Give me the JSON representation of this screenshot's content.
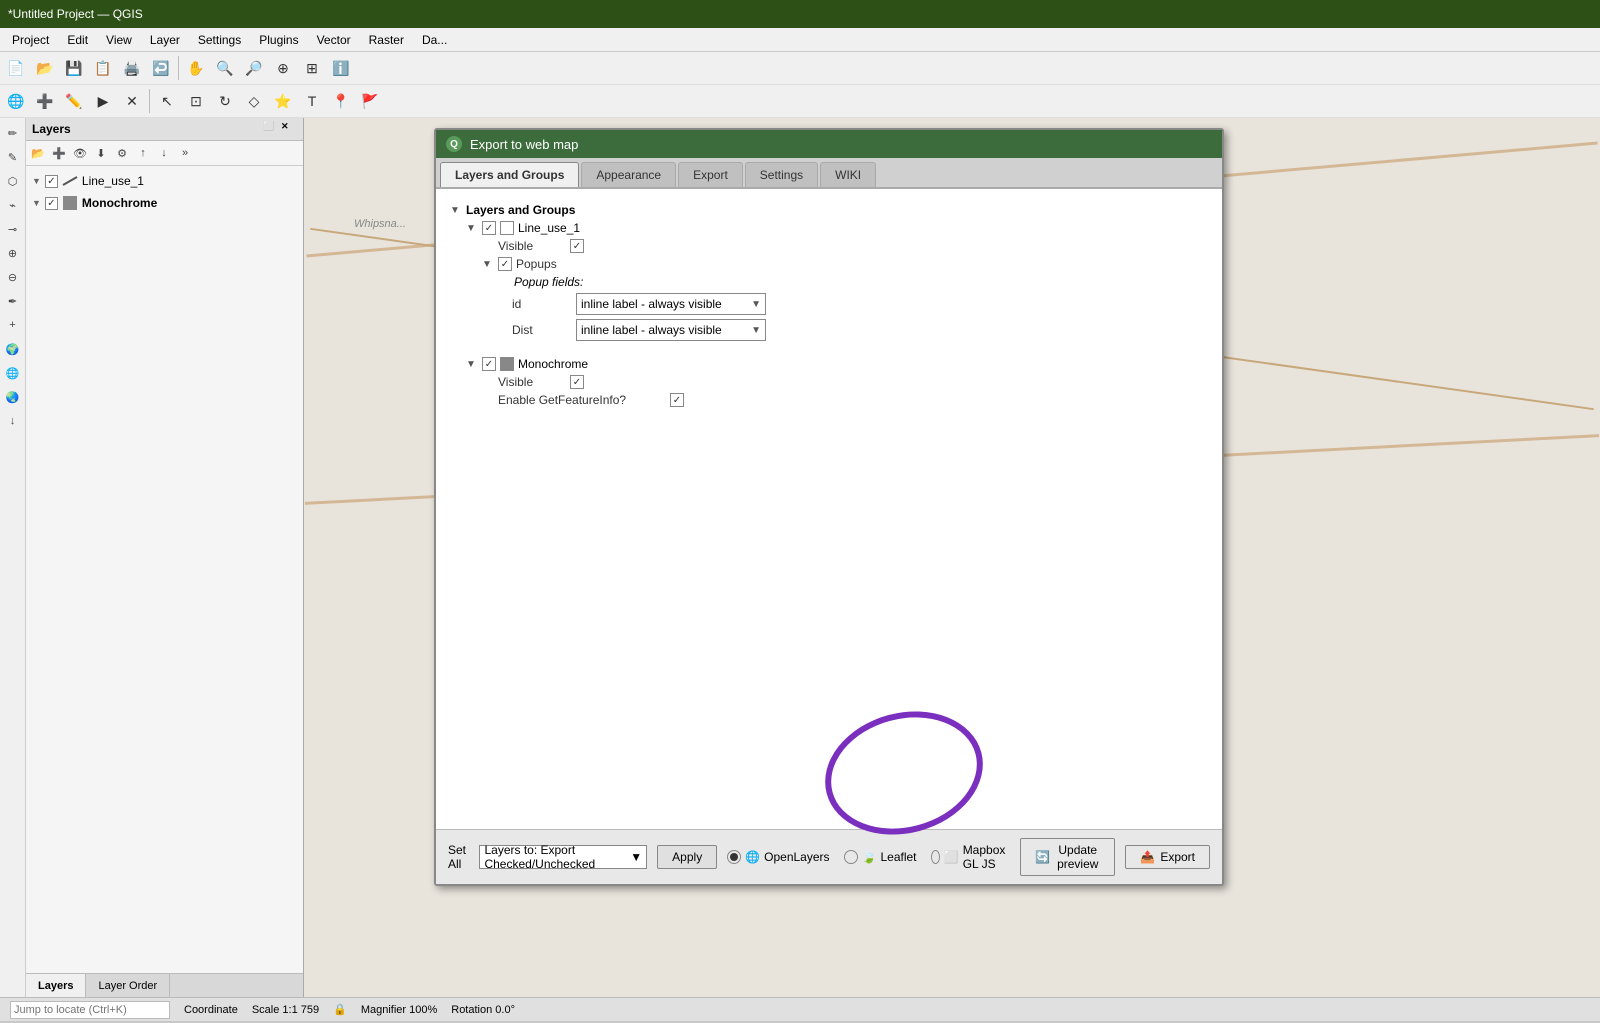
{
  "titleBar": {
    "title": "*Untitled Project — QGIS"
  },
  "menuBar": {
    "items": [
      "Project",
      "Edit",
      "View",
      "Layer",
      "Settings",
      "Plugins",
      "Vector",
      "Raster",
      "Da..."
    ]
  },
  "dialog": {
    "title": "Export to web map",
    "titleIcon": "Q",
    "tabs": [
      {
        "label": "Layers and Groups",
        "active": true
      },
      {
        "label": "Appearance",
        "active": false
      },
      {
        "label": "Export",
        "active": false
      },
      {
        "label": "Settings",
        "active": false
      },
      {
        "label": "WIKI",
        "active": false
      }
    ],
    "tree": {
      "root": {
        "label": "Layers and Groups",
        "expanded": true,
        "children": [
          {
            "label": "Line_use_1",
            "checked": true,
            "expanded": true,
            "children": [
              {
                "label": "Visible",
                "checked": true
              },
              {
                "label": "Popups",
                "checked": true,
                "expanded": true,
                "children": [
                  {
                    "label": "Popup fields:",
                    "fields": [
                      {
                        "name": "id",
                        "value": "inline label - always visible"
                      },
                      {
                        "name": "Dist",
                        "value": "inline label - always visible"
                      }
                    ]
                  }
                ]
              }
            ]
          },
          {
            "label": "Monochrome",
            "checked": true,
            "expanded": true,
            "children": [
              {
                "label": "Visible",
                "checked": true
              },
              {
                "label": "Enable GetFeatureInfo?",
                "checked": true
              }
            ]
          }
        ]
      }
    },
    "bottom": {
      "setAllLabel": "Set All",
      "setAllValue": "Layers to: Export Checked/Unchecked",
      "applyBtn": "Apply",
      "radioOptions": [
        {
          "label": "OpenLayers",
          "selected": true,
          "icon": "🌐"
        },
        {
          "label": "Leaflet",
          "selected": false,
          "icon": "🍃"
        },
        {
          "label": "Mapbox GL JS",
          "selected": false,
          "icon": "⬜"
        }
      ],
      "updatePreviewBtn": "Update preview",
      "exportBtn": "Export"
    }
  },
  "layersPanel": {
    "title": "Layers",
    "layers": [
      {
        "name": "Line_use_1",
        "checked": true,
        "type": "line"
      },
      {
        "name": "Monochrome",
        "checked": true,
        "type": "raster",
        "bold": true
      }
    ],
    "bottomTabs": [
      {
        "label": "Layers",
        "active": true
      },
      {
        "label": "Layer Order",
        "active": false
      }
    ]
  },
  "statusBar": {
    "coordinate": "Coordinate",
    "scale": "Scale 1:1 759",
    "magnifier": "Magnifier 100%",
    "rotation": "Rotation 0.0°"
  },
  "mapLabel": "Whipsna..."
}
